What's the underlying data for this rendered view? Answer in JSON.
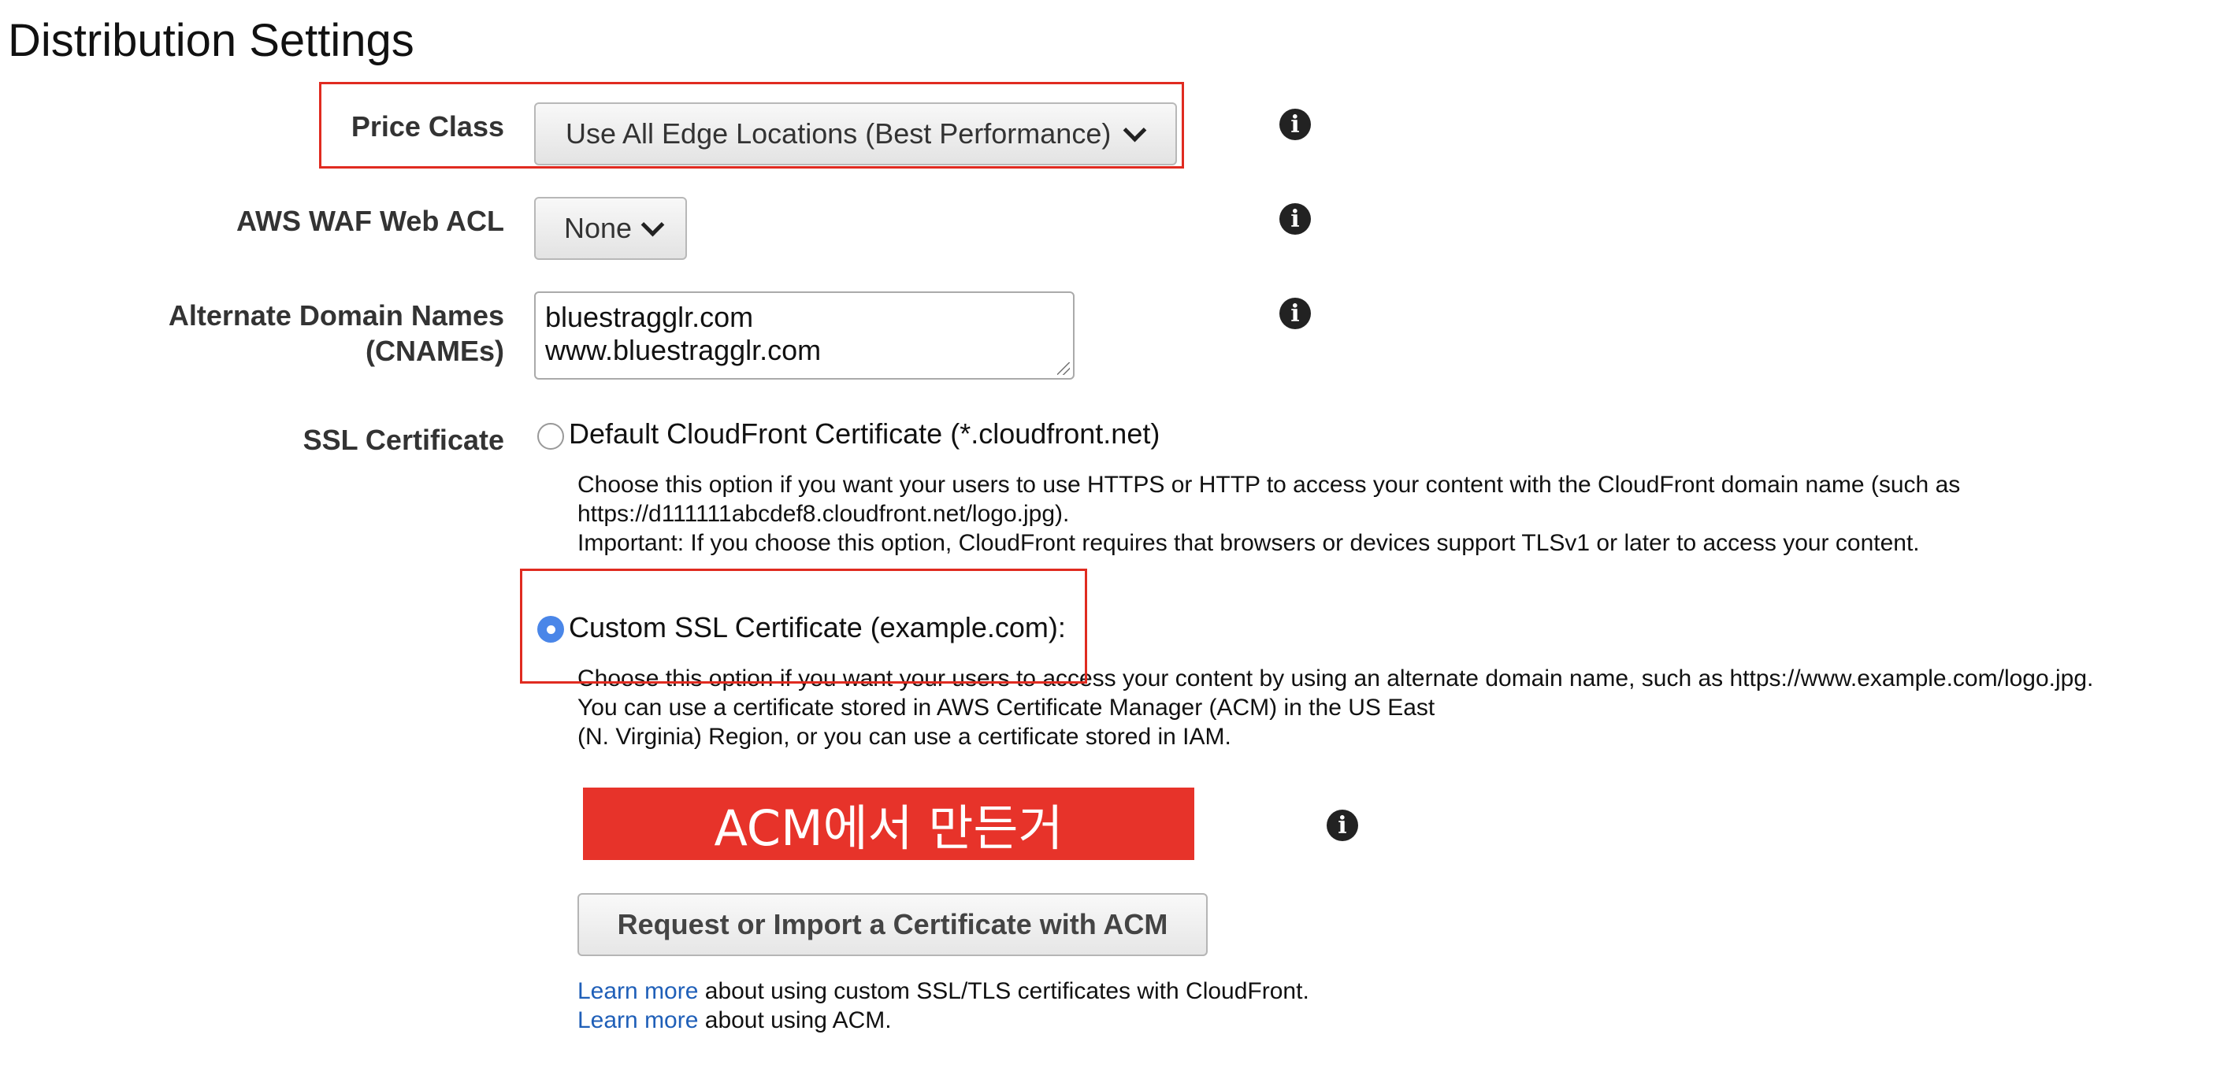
{
  "page": {
    "title": "Distribution Settings"
  },
  "price_class": {
    "label": "Price Class",
    "selected": "Use All Edge Locations (Best Performance)"
  },
  "waf": {
    "label": "AWS WAF Web ACL",
    "selected": "None"
  },
  "cnames": {
    "label_line1": "Alternate Domain Names",
    "label_line2": "(CNAMEs)",
    "values": [
      "bluestragglr.com",
      "www.bluestragglr.com"
    ]
  },
  "ssl": {
    "label": "SSL Certificate",
    "selected_option": "custom",
    "default_option": {
      "label": "Default CloudFront Certificate (*.cloudfront.net)",
      "desc": [
        "Choose this option if you want your users to use HTTPS or HTTP to access your content with the CloudFront domain name (such as",
        "https://d111111abcdef8.cloudfront.net/logo.jpg).",
        "Important: If you choose this option, CloudFront requires that browsers or devices support TLSv1 or later to access your content."
      ]
    },
    "custom_option": {
      "label": "Custom SSL Certificate (example.com):",
      "desc": [
        "Choose this option if you want your users to access your content by using an alternate domain name, such as https://www.example.com/logo.jpg.",
        "You can use a certificate stored in AWS Certificate Manager (ACM) in the US East",
        "(N. Virginia) Region, or you can use a certificate stored in IAM."
      ]
    },
    "acm_annotation": "ACM에서 만든거",
    "request_button": "Request or Import a Certificate with ACM",
    "learn_more_1": {
      "link": "Learn more",
      "text": " about using custom SSL/TLS certificates with CloudFront."
    },
    "learn_more_2": {
      "link": "Learn more",
      "text": " about using ACM."
    }
  },
  "icons": {
    "info": "info-icon"
  },
  "colors": {
    "highlight": "#e02b20",
    "banner": "#e7332a",
    "radio_selected": "#4a86e8",
    "link": "#1f5fb8"
  }
}
